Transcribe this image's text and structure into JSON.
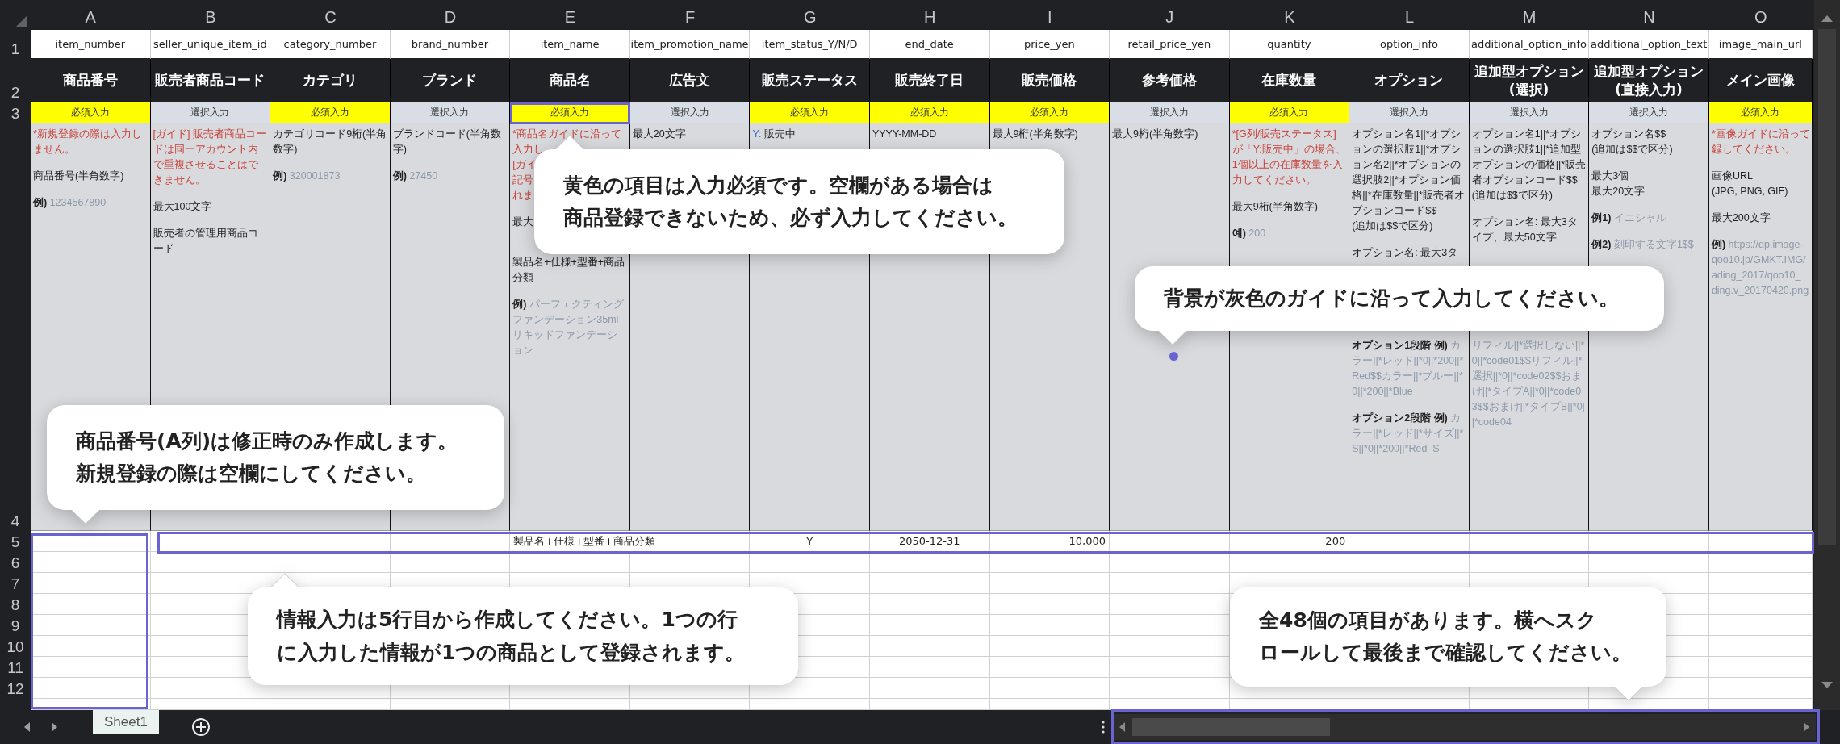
{
  "columns": [
    {
      "letter": "A",
      "field": "item_number",
      "header": "商品番号",
      "requirement": "必須入力",
      "required": true,
      "guide": {
        "lines": [
          {
            "kind": "note",
            "lines": [
              "*新規登録の際は入力しません。"
            ]
          },
          {
            "kind": "text",
            "lines": [
              "商品番号(半角数字)"
            ]
          },
          {
            "kind": "example",
            "label": "例)",
            "lines": [
              "1234567890"
            ]
          }
        ]
      }
    },
    {
      "letter": "B",
      "field": "seller_unique_item_id",
      "header": "販売者商品コード",
      "requirement": "選択入力",
      "required": false,
      "guide": {
        "lines": [
          {
            "kind": "note",
            "lines": [
              "[ガイド] 販売者商品コードは同一アカウント内で重複させることはできません。"
            ]
          },
          {
            "kind": "text",
            "lines": [
              "最大100文字"
            ]
          },
          {
            "kind": "text",
            "lines": [
              "販売者の管理用商品コード"
            ]
          }
        ]
      }
    },
    {
      "letter": "C",
      "field": "category_number",
      "header": "カテゴリ",
      "requirement": "必須入力",
      "required": true,
      "guide": {
        "lines": [
          {
            "kind": "text",
            "lines": [
              "カテゴリコード9桁(半角数字)"
            ]
          },
          {
            "kind": "example",
            "label": "例)",
            "lines": [
              "320001873"
            ]
          }
        ]
      }
    },
    {
      "letter": "D",
      "field": "brand_number",
      "header": "ブランド",
      "requirement": "選択入力",
      "required": false,
      "guide": {
        "lines": [
          {
            "kind": "text",
            "lines": [
              "ブランドコード(半角数字)"
            ]
          },
          {
            "kind": "example",
            "label": "例)",
            "lines": [
              "27450"
            ]
          }
        ]
      }
    },
    {
      "letter": "E",
      "field": "item_name",
      "header": "商品名",
      "requirement": "必須入力",
      "required": true,
      "guide": {
        "lines": [
          {
            "kind": "note",
            "lines": [
              "*商品名ガイドに沿って",
              "入力し",
              "[ガイ",
              "記号",
              "れま"
            ]
          },
          {
            "kind": "text",
            "lines": [
              "最大"
            ]
          }
        ],
        "lines_below": [
          {
            "kind": "text",
            "lines": [
              "製品名+仕様+型番+商品分類"
            ]
          },
          {
            "kind": "example",
            "label": "例)",
            "lines": [
              "パーフェクティングファンデーション35mlリキッドファンデーション"
            ]
          }
        ]
      }
    },
    {
      "letter": "F",
      "field": "item_promotion_name",
      "header": "広告文",
      "requirement": "選択入力",
      "required": false,
      "guide": {
        "lines": [
          {
            "kind": "text",
            "lines": [
              "最大20文字"
            ]
          }
        ]
      }
    },
    {
      "letter": "G",
      "field": "item_status_Y/N/D",
      "header": "販売ステータス",
      "requirement": "必須入力",
      "required": true,
      "guide": {
        "lines": [
          {
            "kind": "key",
            "label": "Y:",
            "lines": [
              "販売中"
            ]
          }
        ]
      }
    },
    {
      "letter": "H",
      "field": "end_date",
      "header": "販売終了日",
      "requirement": "必須入力",
      "required": true,
      "guide": {
        "lines": [
          {
            "kind": "text",
            "lines": [
              "YYYY-MM-DD"
            ]
          }
        ]
      }
    },
    {
      "letter": "I",
      "field": "price_yen",
      "header": "販売価格",
      "requirement": "必須入力",
      "required": true,
      "guide": {
        "lines": [
          {
            "kind": "text",
            "lines": [
              "最大9桁(半角数字)"
            ]
          }
        ]
      }
    },
    {
      "letter": "J",
      "field": "retail_price_yen",
      "header": "参考価格",
      "requirement": "選択入力",
      "required": false,
      "guide": {
        "lines": [
          {
            "kind": "text",
            "lines": [
              "最大9桁(半角数字)"
            ]
          }
        ]
      }
    },
    {
      "letter": "K",
      "field": "quantity",
      "header": "在庫数量",
      "requirement": "必須入力",
      "required": true,
      "guide": {
        "lines": [
          {
            "kind": "note",
            "lines": [
              "*[G列/販売ステータス]が「Y:販売中」の場合、1個以上の在庫数量を入力してください。"
            ]
          },
          {
            "kind": "text",
            "lines": [
              "最大9桁(半角数字)"
            ]
          },
          {
            "kind": "example",
            "label": "예)",
            "lines": [
              "200"
            ]
          }
        ]
      }
    },
    {
      "letter": "L",
      "field": "option_info",
      "header": "オプション",
      "requirement": "選択入力",
      "required": false,
      "guide": {
        "lines": [
          {
            "kind": "text",
            "lines": [
              "オプション名1||*オプションの選択肢1||*オプション名2||*オプションの選択肢2||*オプション価格||*在庫数量||*販売者オプションコード$$",
              "(追加は$$で区分)"
            ]
          },
          {
            "kind": "text",
            "lines": [
              "オプション名: 最大3タ"
            ]
          }
        ],
        "lines_below": [
          {
            "kind": "example",
            "label": "オプション1段階 例)",
            "lines": [
              "カラー||*レッド||*0||*200||*Red$$カラー||*ブルー||*0||*200||*Blue"
            ]
          },
          {
            "kind": "example",
            "label": "オプション2段階 例)",
            "lines": [
              "カラー||*レッド||*サイズ||*S||*0||*200||*Red_S"
            ]
          }
        ]
      }
    },
    {
      "letter": "M",
      "field": "additional_option_info",
      "header": "追加型オプション\n(選択)",
      "requirement": "選択入力",
      "required": false,
      "guide": {
        "lines": [
          {
            "kind": "text",
            "lines": [
              "オプション名1||*オプションの選択肢1||*追加型オプションの価格||*販売者オプションコード$$",
              "(追加は$$で区分)"
            ]
          },
          {
            "kind": "text",
            "lines": [
              "オプション名: 最大3タイプ、最大50文字"
            ]
          }
        ],
        "lines_below": [
          {
            "kind": "sample",
            "lines": [
              "リフィル||*選択しない||*0||*code01$$リフィル||*選択||*0||*code02$$おまけ||*タイプA||*0||*code03$$おまけ||*タイプB||*0||*code04"
            ]
          }
        ]
      }
    },
    {
      "letter": "N",
      "field": "additional_option_text",
      "header": "追加型オプション\n(直接入力)",
      "requirement": "選択入力",
      "required": false,
      "guide": {
        "lines": [
          {
            "kind": "text",
            "lines": [
              "オプション名$$",
              "(追加は$$で区分)"
            ]
          },
          {
            "kind": "text",
            "lines": [
              "最大3個",
              "最大20文字"
            ]
          },
          {
            "kind": "example",
            "label": "例1)",
            "lines": [
              "イニシャル"
            ]
          },
          {
            "kind": "example",
            "label": "例2)",
            "lines": [
              "刻印する文字1$$"
            ]
          }
        ]
      }
    },
    {
      "letter": "O",
      "field": "image_main_url",
      "header": "メイン画像",
      "requirement": "必須入力",
      "required": true,
      "guide": {
        "lines": [
          {
            "kind": "note",
            "lines": [
              "*画像ガイドに沿って",
              "録してください。"
            ]
          },
          {
            "kind": "text",
            "lines": [
              "画像URL",
              "(JPG, PNG, GIF)"
            ]
          },
          {
            "kind": "text",
            "lines": [
              "最大200文字"
            ]
          },
          {
            "kind": "example",
            "label": "例)",
            "lines": [
              "https://dp.image-",
              "qoo10.jp/GMKT.IMG/",
              "ading_2017/qoo10_",
              "ding.v_20170420.png"
            ]
          }
        ]
      }
    }
  ],
  "row_numbers": [
    "1",
    "2",
    "3",
    "4"
  ],
  "rows": [
    {
      "number": "5",
      "cells": {
        "E": {
          "kind": "text",
          "text": "製品名+仕様+型番+商品分類"
        },
        "G": {
          "kind": "code",
          "text": "Y"
        },
        "H": {
          "kind": "code",
          "text": "2050-12-31"
        },
        "I": {
          "kind": "number",
          "text": "10,000"
        },
        "K": {
          "kind": "number",
          "text": "200"
        }
      }
    },
    {
      "number": "6"
    },
    {
      "number": "7"
    },
    {
      "number": "8"
    },
    {
      "number": "9"
    },
    {
      "number": "10"
    },
    {
      "number": "11"
    },
    {
      "number": "12"
    }
  ],
  "sheets": [
    {
      "label": "Sheet1",
      "selected": true
    }
  ],
  "callouts": [
    {
      "lines": [
        "黄色の項目は入力必須です。空欄がある場合は",
        "商品登録できないため、必ず入力してください。"
      ]
    },
    {
      "lines": [
        "背景が灰色のガイドに沿って入力してください。"
      ]
    },
    {
      "lines": [
        "商品番号(A列)は修正時のみ作成します。",
        "新規登録の際は空欄にしてください。"
      ]
    },
    {
      "lines": [
        "情報入力は5行目から作成してください。1つの行",
        "に入力した情報が1つの商品として登録されます。"
      ]
    },
    {
      "lines": [
        "全48個の項目があります。横へスク",
        "ロールして最後まで確認してください。"
      ]
    }
  ]
}
